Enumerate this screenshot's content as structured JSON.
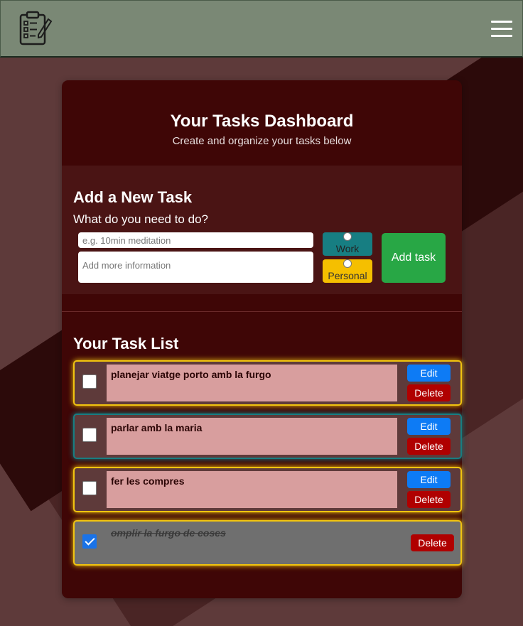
{
  "header": {
    "logo_icon": "clipboard-checklist-icon",
    "menu_icon": "hamburger-menu-icon"
  },
  "dashboard": {
    "title": "Your Tasks Dashboard",
    "subtitle": "Create and organize your tasks below"
  },
  "add_task": {
    "heading": "Add a New Task",
    "prompt": "What do you need to do?",
    "title_placeholder": "e.g. 10min meditation",
    "description_placeholder": "Add more information",
    "categories": [
      {
        "label": "Work",
        "color": "#177e82",
        "selected": false
      },
      {
        "label": "Personal",
        "color": "#f5bf00",
        "selected": false
      }
    ],
    "add_button_label": "Add task"
  },
  "task_list": {
    "heading": "Your Task List",
    "edit_label": "Edit",
    "delete_label": "Delete",
    "tasks": [
      {
        "text": "planejar viatge porto amb la furgo",
        "category": "Personal",
        "done": false
      },
      {
        "text": "parlar amb la maria",
        "category": "Work",
        "done": false
      },
      {
        "text": "fer les compres",
        "category": "Personal",
        "done": false
      },
      {
        "text": "omplir la furgo de coses",
        "category": "Personal",
        "done": true
      }
    ]
  },
  "colors": {
    "background": "#5e3a3a",
    "navbar": "#7a8875",
    "card": "#3f0606",
    "work": "#177e82",
    "personal": "#f5bf00",
    "add_button": "#28a745",
    "edit_button": "#0d7bf5",
    "delete_button": "#b00000"
  }
}
